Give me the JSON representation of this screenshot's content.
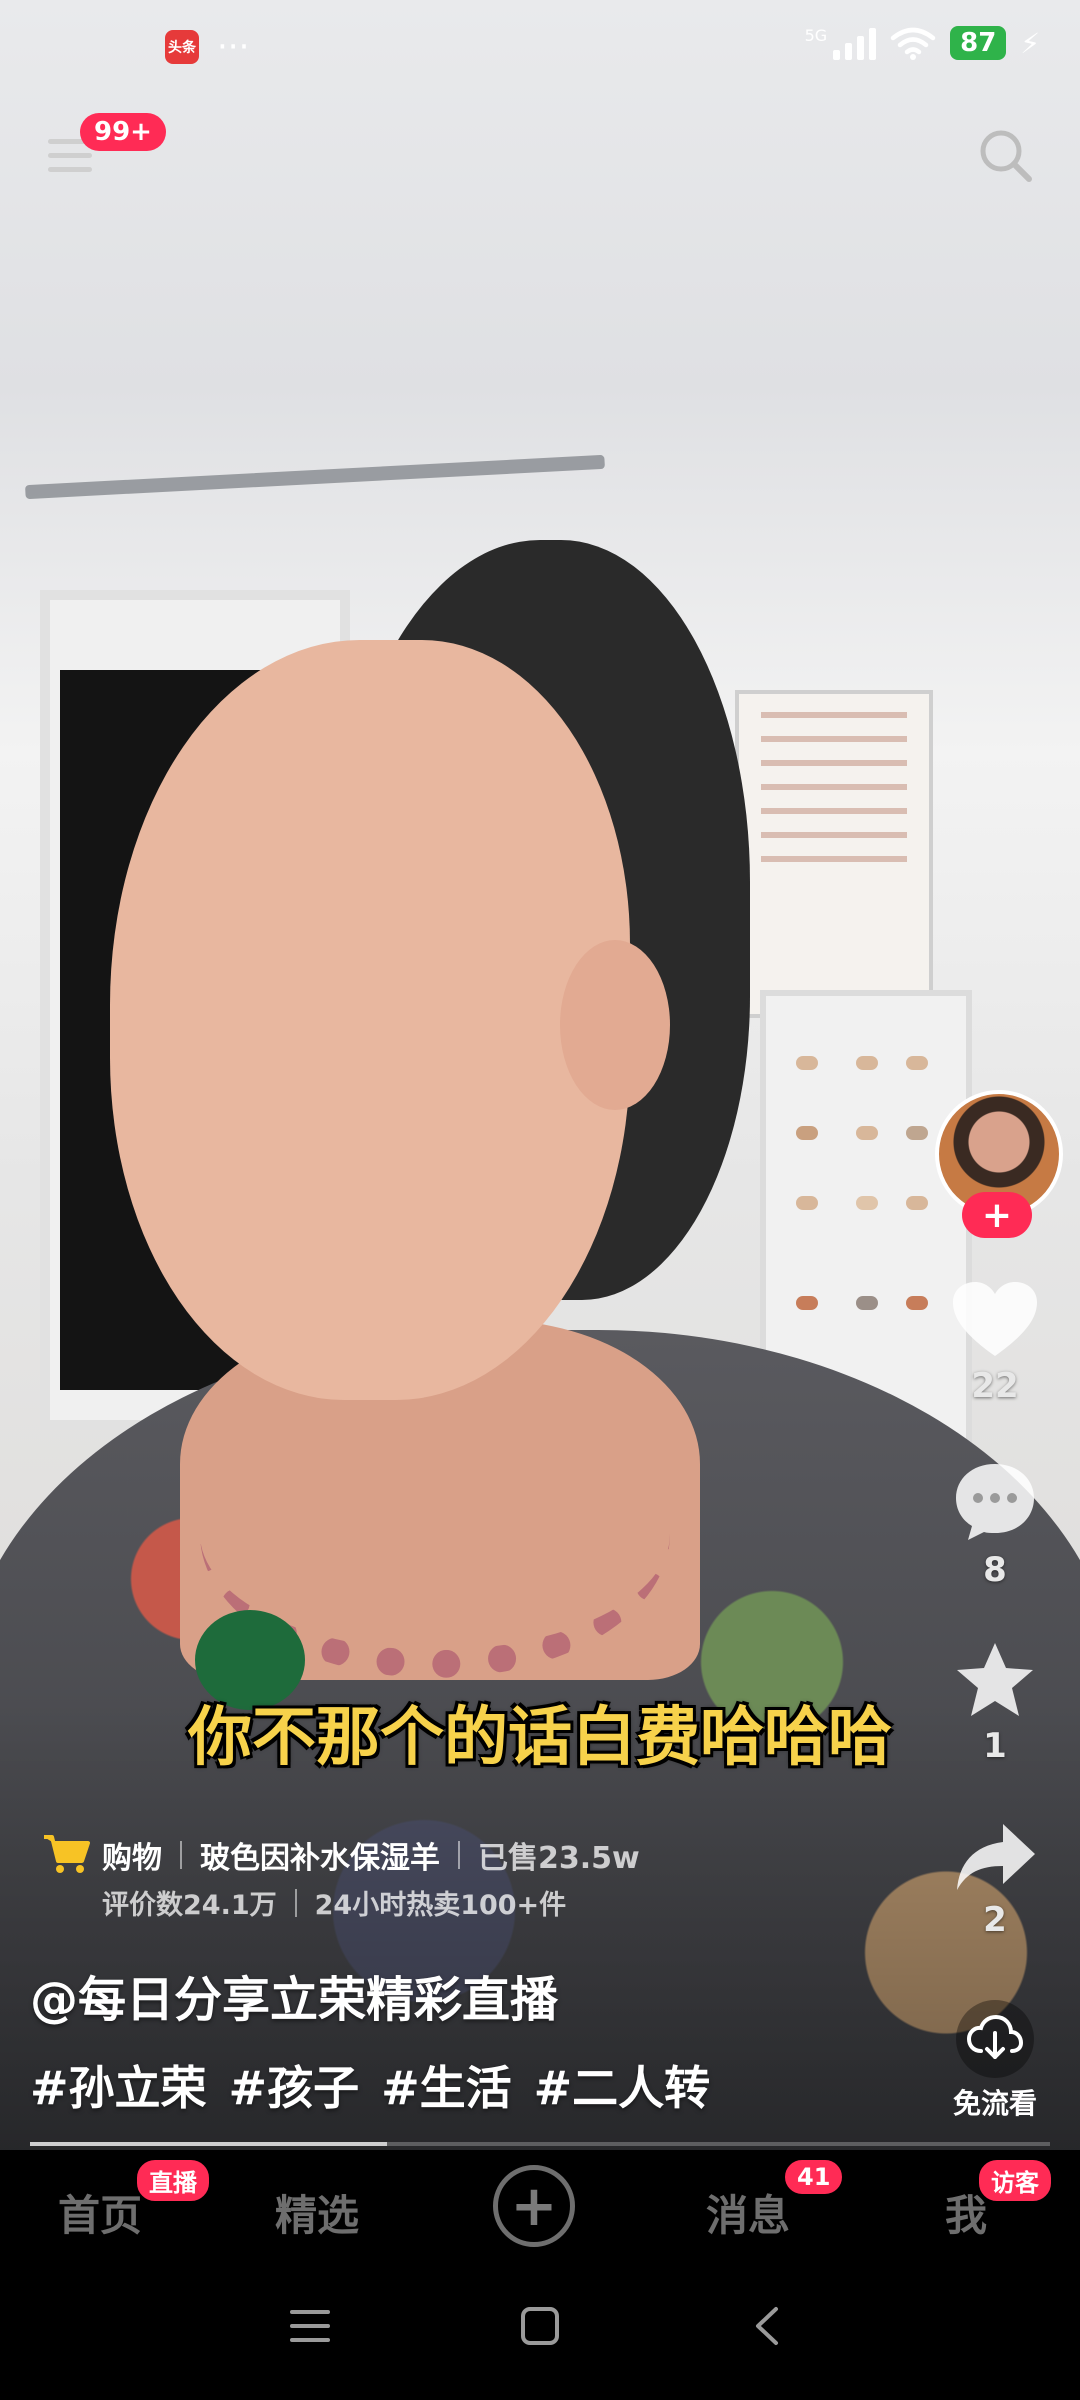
{
  "status_bar": {
    "app_badge_text": "头条",
    "more_text": "···",
    "network": "5G",
    "battery": "87"
  },
  "top_bar": {
    "menu_badge": "99+"
  },
  "video": {
    "subtitle": "你不那个的话白费哈哈哈",
    "author": "@每日分享立荣精彩直播",
    "tags": [
      "#孙立荣",
      "#孩子",
      "#生活",
      "#二人转"
    ],
    "progress": 0.35
  },
  "shopping": {
    "label": "购物",
    "product": "玻色因补水保湿羊",
    "sold": "已售23.5w",
    "reviews": "评价数24.1万",
    "hot": "24小时热卖100+件"
  },
  "actions": {
    "follow_label": "+",
    "like_count": "22",
    "comment_count": "8",
    "favorite_count": "1",
    "share_count": "2",
    "download_label": "免流看"
  },
  "bottom_nav": {
    "home": "首页",
    "home_badge": "直播",
    "featured": "精选",
    "plus": "+",
    "messages": "消息",
    "messages_badge": "41",
    "me": "我",
    "me_badge": "访客"
  },
  "colors": {
    "accent": "#ff2b55",
    "subtitle": "#f7d24b",
    "battery": "#2fb34a"
  }
}
